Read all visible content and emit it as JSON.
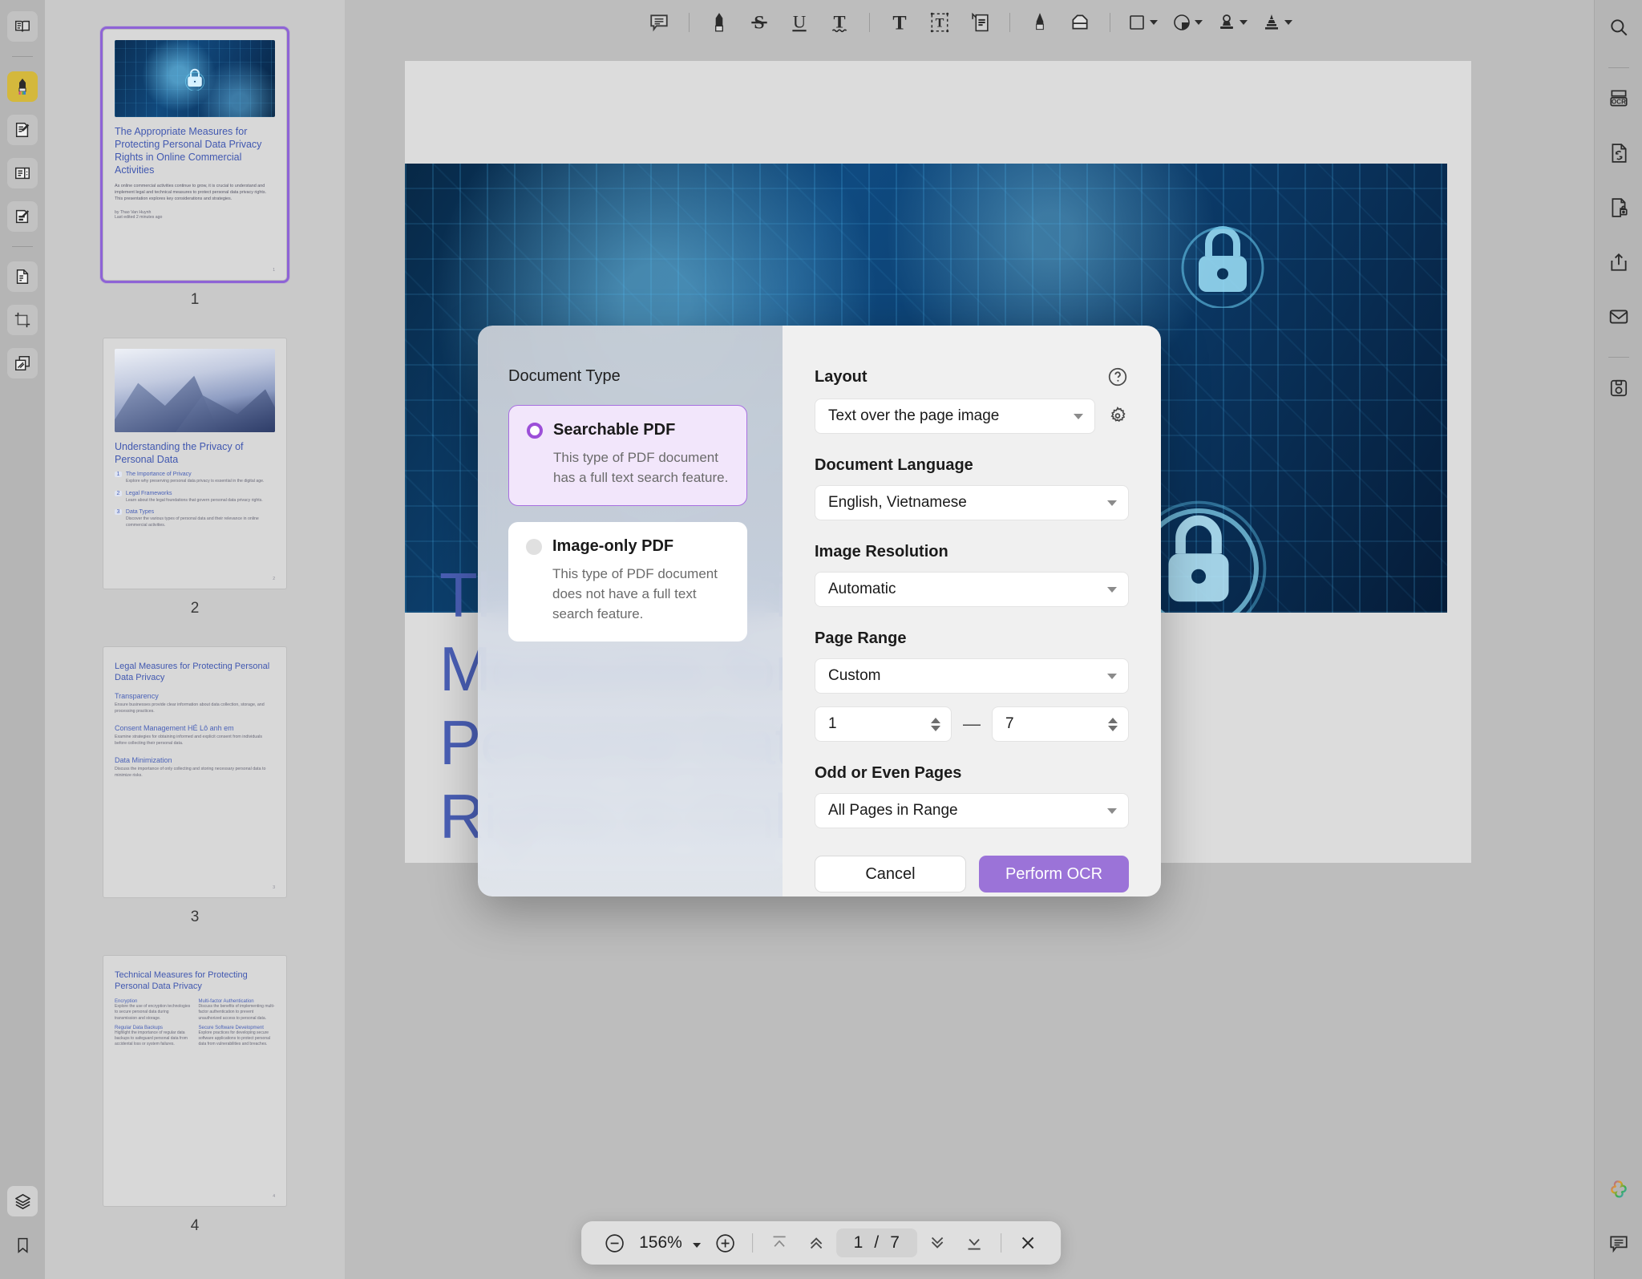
{
  "app": {
    "zoom_level": "156%",
    "current_page": "1",
    "page_separator": "/",
    "total_pages": "7",
    "accent_color": "#9b73d8",
    "highlight_tool_color": "#d4b83c"
  },
  "left_rail": {
    "items": [
      {
        "name": "read-mode-icon",
        "label": "Read Mode"
      },
      {
        "name": "highlighter-icon",
        "label": "Highlight",
        "active": true
      },
      {
        "name": "edit-text-icon",
        "label": "Edit Text"
      },
      {
        "name": "form-fields-icon",
        "label": "Form Fields"
      },
      {
        "name": "markup-icon",
        "label": "Markup"
      },
      {
        "name": "page-edit-icon",
        "label": "Page Edit"
      },
      {
        "name": "crop-icon",
        "label": "Crop"
      },
      {
        "name": "organize-pages-icon",
        "label": "Organize Pages"
      }
    ],
    "bottom_items": [
      {
        "name": "layers-icon",
        "label": "Layers",
        "active": true
      },
      {
        "name": "bookmark-icon",
        "label": "Bookmarks"
      }
    ]
  },
  "right_rail": {
    "items": [
      {
        "name": "search-icon",
        "label": "Search"
      },
      {
        "name": "ocr-icon",
        "label": "OCR"
      },
      {
        "name": "convert-icon",
        "label": "Convert"
      },
      {
        "name": "protect-icon",
        "label": "Protect"
      },
      {
        "name": "share-icon",
        "label": "Share"
      },
      {
        "name": "mail-icon",
        "label": "Email"
      },
      {
        "name": "save-icon",
        "label": "Save"
      }
    ],
    "bottom_items": [
      {
        "name": "ai-assistant-icon",
        "label": "AI Assistant"
      },
      {
        "name": "comment-icon",
        "label": "Comments"
      }
    ]
  },
  "top_toolbar": {
    "items": [
      {
        "name": "note-icon",
        "label": "Sticky Note"
      },
      {
        "name": "highlight-icon",
        "label": "Highlight"
      },
      {
        "name": "strikethrough-icon",
        "label": "Strikethrough"
      },
      {
        "name": "underline-icon",
        "label": "Underline"
      },
      {
        "name": "squiggly-icon",
        "label": "Squiggly Underline"
      },
      {
        "name": "text-icon",
        "label": "Add Text"
      },
      {
        "name": "text-box-icon",
        "label": "Text Box"
      },
      {
        "name": "callout-icon",
        "label": "Callout"
      },
      {
        "name": "pen-icon",
        "label": "Pen"
      },
      {
        "name": "eraser-icon",
        "label": "Eraser"
      },
      {
        "name": "shape-icon",
        "label": "Shapes"
      },
      {
        "name": "shape-fill-icon",
        "label": "Fill Color"
      },
      {
        "name": "stamp-icon",
        "label": "Stamp"
      },
      {
        "name": "signature-icon",
        "label": "Signature"
      }
    ]
  },
  "thumbnails": [
    {
      "number": "1",
      "selected": true,
      "kind": "cover",
      "title": "The Appropriate Measures for Protecting Personal Data Privacy Rights in Online Commercial Activities",
      "body": "As online commercial activities continue to grow, it is crucial to understand and implement legal and technical measures to protect personal data privacy rights. This presentation explores key considerations and strategies.",
      "author": "by Thao Van Huynh",
      "author_meta": "Last edited 2 minutes ago",
      "page_footer": "1"
    },
    {
      "number": "2",
      "selected": false,
      "kind": "agenda",
      "title": "Understanding the Privacy of Personal Data",
      "sections": [
        {
          "n": "1",
          "h": "The Importance of Privacy",
          "p": "Explore why preserving personal data privacy is essential in the digital age."
        },
        {
          "n": "2",
          "h": "Legal Frameworks",
          "p": "Learn about the legal foundations that govern personal data privacy rights."
        },
        {
          "n": "3",
          "h": "Data Types",
          "p": "Discover the various types of personal data and their relevance in online commercial activities."
        }
      ],
      "page_footer": "2"
    },
    {
      "number": "3",
      "selected": false,
      "kind": "text",
      "title": "Legal Measures for Protecting Personal Data Privacy",
      "blocks": [
        {
          "h": "Transparency",
          "p": "Ensure businesses provide clear information about data collection, storage, and processing practices."
        },
        {
          "h": "Consent Management HÉ Lô anh em",
          "p": "Examine strategies for obtaining informed and explicit consent from individuals before collecting their personal data."
        },
        {
          "h": "Data Minimization",
          "p": "Discuss the importance of only collecting and storing necessary personal data to minimize risks."
        }
      ],
      "page_footer": "3"
    },
    {
      "number": "4",
      "selected": false,
      "kind": "grid",
      "title": "Technical Measures for Protecting Personal Data Privacy",
      "cells": [
        {
          "h": "Encryption",
          "p": "Explore the use of encryption technologies to secure personal data during transmission and storage."
        },
        {
          "h": "Multi-factor Authentication",
          "p": "Discuss the benefits of implementing multi-factor authentication to prevent unauthorized access to personal data."
        },
        {
          "h": "Regular Data Backups",
          "p": "Highlight the importance of regular data backups to safeguard personal data from accidental loss or system failures."
        },
        {
          "h": "Secure Software Development",
          "p": "Explore practices for developing secure software applications to protect personal data from vulnerabilities and breaches."
        }
      ],
      "page_footer": "4"
    }
  ],
  "document": {
    "title": "The Appropriate Measures for Protecting Personal Data Privacy Rights in Online"
  },
  "modal": {
    "left": {
      "section_label": "Document Type",
      "options": [
        {
          "id": "searchable-pdf",
          "title": "Searchable PDF",
          "description": "This type of PDF document has a full text search feature.",
          "selected": true
        },
        {
          "id": "image-only-pdf",
          "title": "Image-only PDF",
          "description": "This type of PDF document does not have a full text search feature.",
          "selected": false
        }
      ]
    },
    "right": {
      "layout_label": "Layout",
      "layout_value": "Text over the page image",
      "help_icon": "help-circle-icon",
      "settings_icon": "gear-icon",
      "language_label": "Document Language",
      "language_value": "English, Vietnamese",
      "resolution_label": "Image Resolution",
      "resolution_value": "Automatic",
      "page_range_label": "Page Range",
      "page_range_value": "Custom",
      "range_from": "1",
      "range_dash": "—",
      "range_to": "7",
      "odd_even_label": "Odd or Even Pages",
      "odd_even_value": "All Pages in Range",
      "cancel_label": "Cancel",
      "confirm_label": "Perform OCR"
    }
  },
  "bottom_bar": {
    "zoom_out_icon": "minus-circle-icon",
    "zoom_in_icon": "plus-circle-icon",
    "zoom_label": "156%",
    "first_page_icon": "first-page-icon",
    "prev_page_icon": "prev-page-icon",
    "next_page_icon": "next-page-icon",
    "last_page_icon": "last-page-icon",
    "close_icon": "close-icon",
    "page_current": "1",
    "page_sep": "/",
    "page_total": "7"
  }
}
